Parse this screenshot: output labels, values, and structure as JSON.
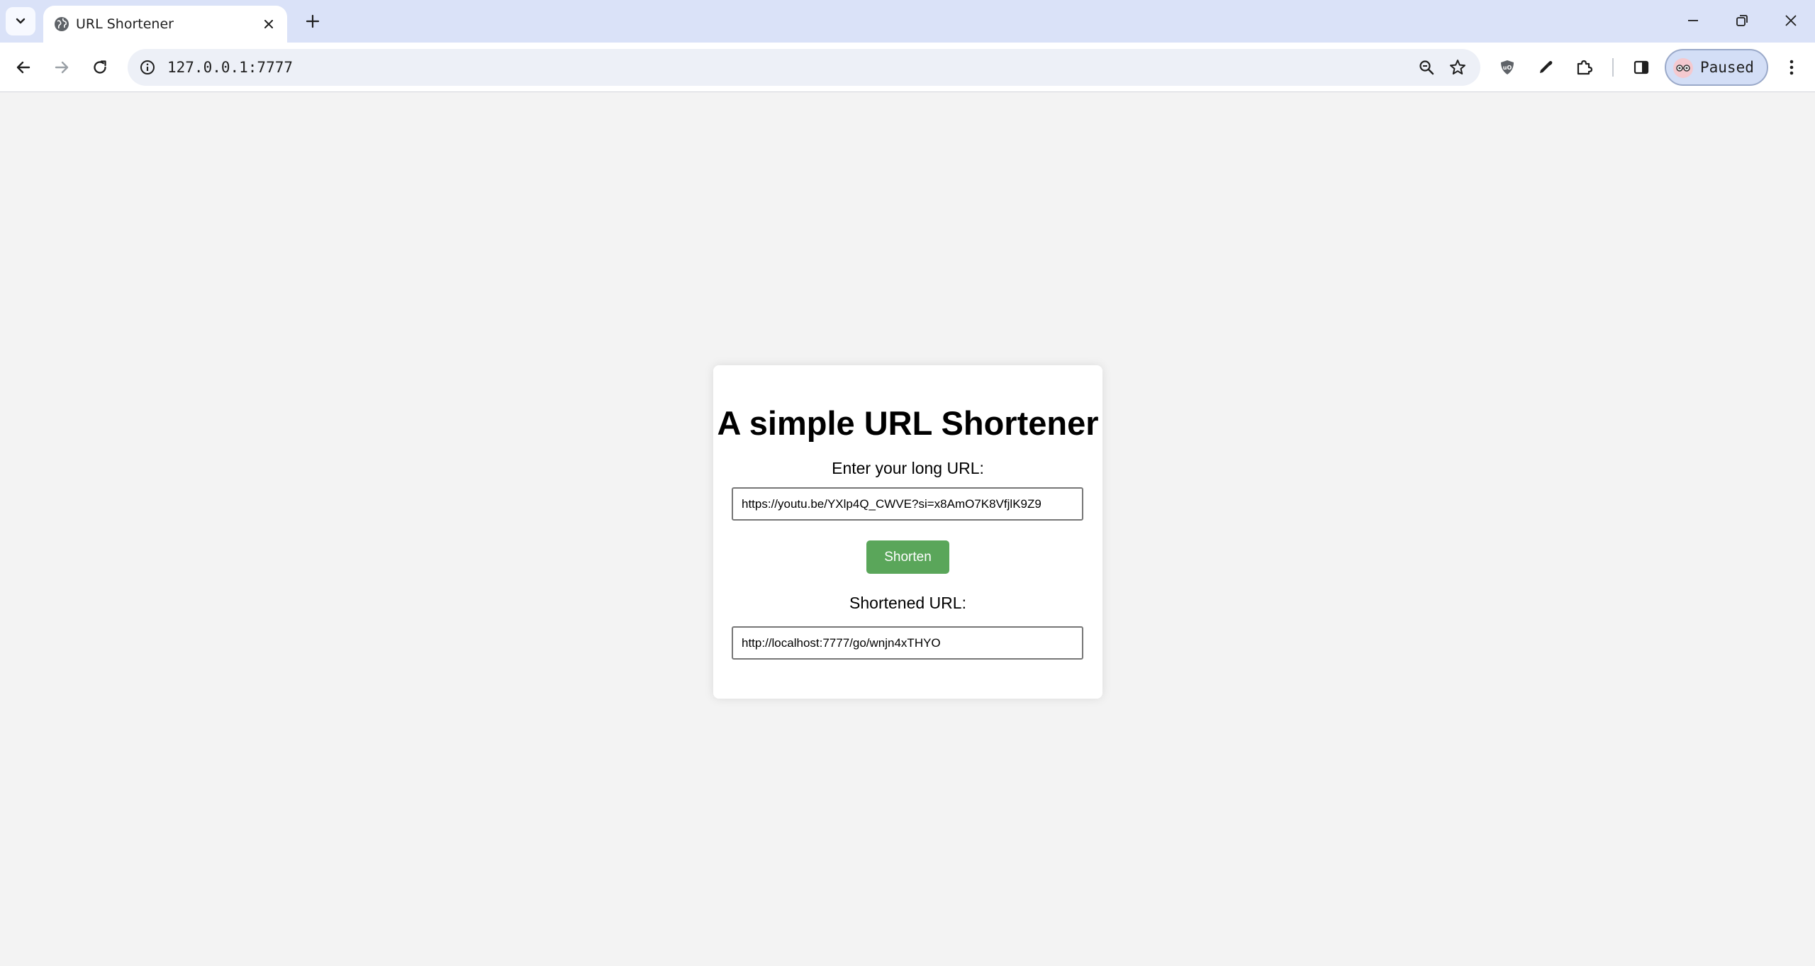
{
  "browser": {
    "tab_title": "URL Shortener",
    "address": "127.0.0.1:7777",
    "profile_label": "Paused",
    "icons": [
      "tab-search-icon",
      "globe-icon",
      "close-icon",
      "plus-icon",
      "minimize-icon",
      "restore-icon",
      "close-window-icon",
      "back-icon",
      "forward-icon",
      "reload-icon",
      "info-icon",
      "zoom-icon",
      "star-icon",
      "ublock-icon",
      "eyedropper-icon",
      "extensions-icon",
      "side-panel-icon",
      "more-vert-icon"
    ],
    "colors": {
      "tabbar": "#dae2f8",
      "toolbar": "#ffffff",
      "omnibox": "#edf0f7"
    }
  },
  "page": {
    "heading": "A simple URL Shortener",
    "long_url_label": "Enter your long URL:",
    "long_url_value": "https://youtu.be/YXlp4Q_CWVE?si=x8AmO7K8VfjlK9Z9",
    "shorten_button": "Shorten",
    "short_url_label": "Shortened URL:",
    "short_url_value": "http://localhost:7777/go/wnjn4xTHYO",
    "colors": {
      "background": "#f3f3f3",
      "card": "#ffffff",
      "button": "#5aa65a"
    }
  }
}
